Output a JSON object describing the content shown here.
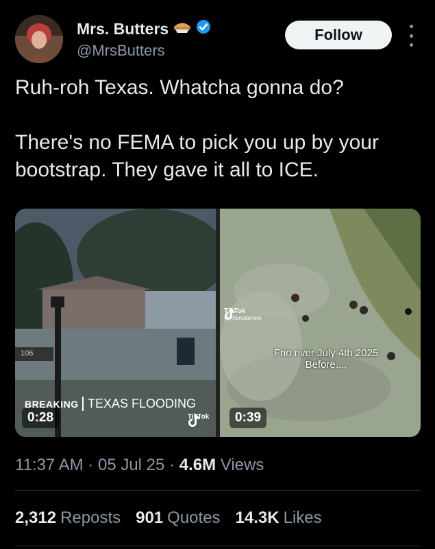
{
  "author": {
    "name": "Mrs. Butters",
    "handle": "@MrsButters",
    "badge_icon": "pie-emoji",
    "verified_icon": "verified-badge-icon",
    "verified_color": "#1d9bf0"
  },
  "follow_label": "Follow",
  "post": {
    "line1": "Ruh-roh Texas. Whatcha gonna do?",
    "line2": "There's no FEMA to pick you up by your bootstrap. They gave it all to ICE."
  },
  "media": [
    {
      "overlay_breaking": "BREAKING",
      "overlay_headline": "TEXAS FLOODING",
      "duration": "0:28",
      "sign_text": "106",
      "tiktok_label": "TikTok"
    },
    {
      "tiktok_label": "TikTok",
      "tiktok_user": "@ thenolamom",
      "caption_line1": "Frio river July 4th 2025",
      "caption_line2": "Before....",
      "duration": "0:39"
    }
  ],
  "meta": {
    "time": "11:37 AM",
    "date": "05 Jul 25",
    "views_count": "4.6M",
    "views_label": "Views"
  },
  "stats": {
    "reposts_count": "2,312",
    "reposts_label": "Reposts",
    "quotes_count": "901",
    "quotes_label": "Quotes",
    "likes_count": "14.3K",
    "likes_label": "Likes"
  },
  "colors": {
    "background": "#000000",
    "text": "#e7e9ea",
    "muted": "#8b98a5",
    "divider": "#2f3336"
  }
}
